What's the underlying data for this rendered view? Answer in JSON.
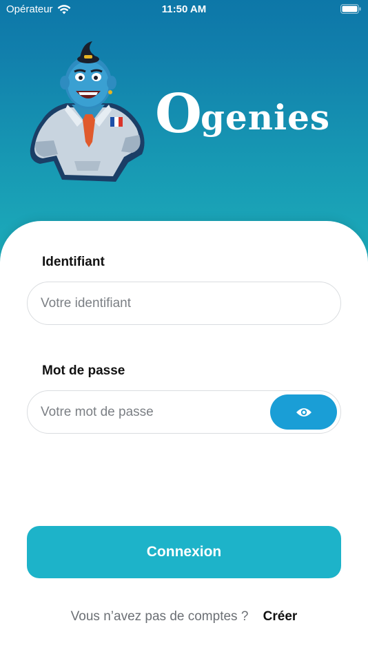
{
  "status_bar": {
    "carrier": "Opérateur",
    "time": "11:50 AM"
  },
  "brand": {
    "initial": "O",
    "rest": "genies"
  },
  "form": {
    "identifier": {
      "label": "Identifiant",
      "placeholder": "Votre identifiant",
      "value": ""
    },
    "password": {
      "label": "Mot de passe",
      "placeholder": "Votre mot de passe",
      "value": ""
    },
    "submit_label": "Connexion"
  },
  "signup": {
    "prompt": "Vous n’avez pas de comptes ?",
    "link_label": "Créer"
  },
  "colors": {
    "gradient_top": "#0d77a8",
    "gradient_bottom": "#1eb1bc",
    "eye_button": "#1a9ed6",
    "primary_button": "#1db3c9"
  },
  "icons": {
    "wifi": "wifi-icon",
    "battery": "battery-icon",
    "eye": "eye-icon"
  }
}
